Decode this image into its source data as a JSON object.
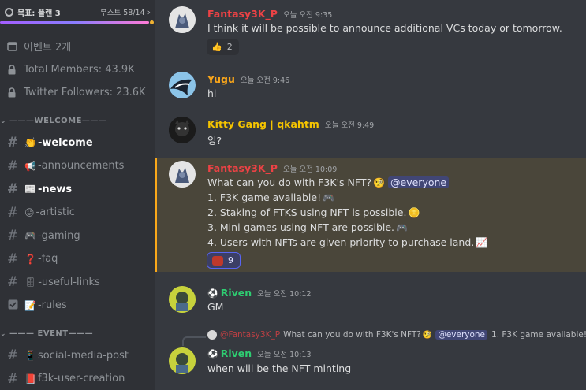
{
  "sidebar": {
    "goal_label": "목표: 플랜 3",
    "boost_label": "부스트 58/14",
    "info": [
      {
        "label": "이벤트 2개",
        "icon": "calendar-icon"
      },
      {
        "label": "Total Members: 43.9K",
        "icon": "lock-icon"
      },
      {
        "label": "Twitter Followers: 23.6K",
        "icon": "lock-icon"
      }
    ],
    "category_welcome": "———WELCOME———",
    "category_event": "——— EVENT———",
    "channels": [
      {
        "label": "-welcome",
        "emoji": "👏",
        "active": true
      },
      {
        "label": "-announcements",
        "emoji": "📢"
      },
      {
        "label": "-news",
        "emoji": "📰",
        "active": true
      },
      {
        "label": "-artistic",
        "emoji": "😛"
      },
      {
        "label": "-gaming",
        "emoji": "🎮"
      },
      {
        "label": "-faq",
        "emoji": "❓"
      },
      {
        "label": "-useful-links",
        "emoji": "🎚"
      },
      {
        "label": "-rules",
        "emoji": "📝"
      }
    ],
    "event_channels": [
      {
        "label": "social-media-post",
        "emoji": "📱"
      },
      {
        "label": "f3k-user-creation",
        "emoji": "📕"
      }
    ]
  },
  "messages": [
    {
      "user": "Fantasy3K_P",
      "time": "오늘 오전 9:35",
      "text": "I think it will be possible to announce additional VCs today or tomorrow.",
      "reaction_emoji": "👍",
      "reaction_count": "2"
    },
    {
      "user": "Yugu",
      "time": "오늘 오전 9:46",
      "text": "hi"
    },
    {
      "user": "Kitty Gang | qkahtm",
      "time": "오늘 오전 9:49",
      "text": "잉?"
    },
    {
      "user": "Fantasy3K_P",
      "time": "오늘 오전 10:09",
      "line1": "What can you do with F3K's NFT?",
      "mention": "@everyone",
      "line2": "1. F3K game available!",
      "line3": "2. Staking of FTKS using NFT is possible.",
      "line4": "3. Mini-games using NFT are possible.",
      "line5": "4. Users with NFTs are given priority to purchase land.",
      "reaction_count": "9"
    },
    {
      "user": "Riven",
      "time": "오늘 오전 10:12",
      "text": "GM"
    },
    {
      "user": "Riven",
      "time": "오늘 오전 10:13",
      "text": "when will be the NFT minting",
      "reply_user": "@Fantasy3K_P",
      "reply_text": "What can you do with F3K's NFT?",
      "reply_mention": "@everyone",
      "reply_tail": "1. F3K game available!"
    }
  ],
  "colors": {
    "fantasy": "#ed4245",
    "yugu": "#faa61a",
    "kitty": "#f5c400",
    "riven": "#2ecc71"
  }
}
